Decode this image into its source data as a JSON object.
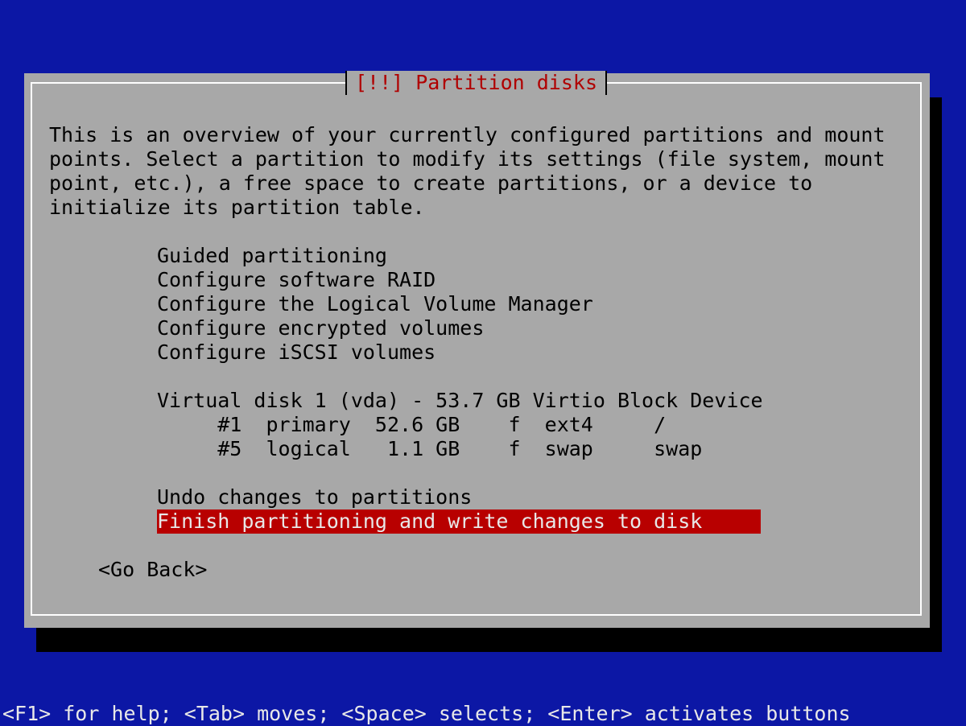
{
  "dialog": {
    "title": "[!!] Partition disks",
    "description_lines": [
      "This is an overview of your currently configured partitions and mount",
      "points. Select a partition to modify its settings (file system, mount",
      "point, etc.), a free space to create partitions, or a device to",
      "initialize its partition table."
    ],
    "menu_items": [
      "Guided partitioning",
      "Configure software RAID",
      "Configure the Logical Volume Manager",
      "Configure encrypted volumes",
      "Configure iSCSI volumes"
    ],
    "disk": {
      "label": "Virtual disk 1 (vda) - 53.7 GB Virtio Block Device",
      "partitions": [
        "     #1  primary  52.6 GB    f  ext4     /",
        "     #5  logical   1.1 GB    f  swap     swap"
      ]
    },
    "actions": [
      "Undo changes to partitions",
      "Finish partitioning and write changes to disk"
    ],
    "go_back_label": "<Go Back>"
  },
  "helpbar": "<F1> for help; <Tab> moves; <Space> selects; <Enter> activates buttons",
  "colors": {
    "background": "#0c17a5",
    "dialog": "#a8a8a8",
    "title": "#b00000",
    "selection": "#b80000"
  }
}
